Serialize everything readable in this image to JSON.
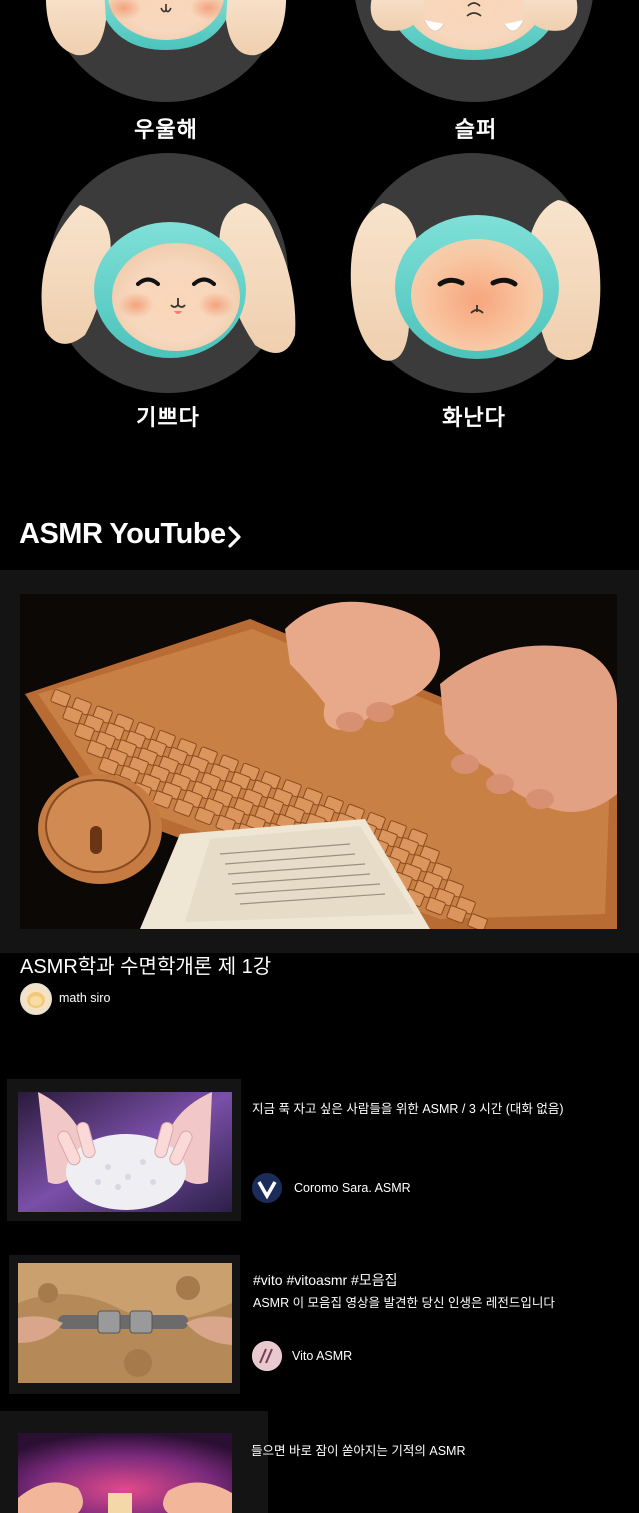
{
  "moods": [
    {
      "label": "우울해",
      "icon": "sad-bunny-icon"
    },
    {
      "label": "슬퍼",
      "icon": "crying-bunny-icon"
    },
    {
      "label": "기쁘다",
      "icon": "happy-bunny-icon"
    },
    {
      "label": "화난다",
      "icon": "angry-bunny-icon"
    }
  ],
  "asmr_section": {
    "title": "ASMR YouTube",
    "more_icon": "chevron-right-icon"
  },
  "featured_video": {
    "thumbnail": "wooden-keyboard-thumbnail",
    "title": "ASMR학과 수면학개론 제 1강",
    "channel": "math siro"
  },
  "videos": [
    {
      "thumbnail": "nails-on-foam-thumbnail",
      "title": "지금 푹 자고 싶은 사람들을 위한 ASMR / 3 시간 (대화 없음)",
      "channel": "Coromo Sara. ASMR"
    },
    {
      "thumbnail": "sand-and-metal-thumbnail",
      "hashtags": "#vito #vitoasmr #모음집",
      "title": "ASMR 이 모음집 영상을 발견한 당신 인생은 레전드입니다",
      "channel": "Vito ASMR"
    },
    {
      "thumbnail": "purple-light-hands-thumbnail",
      "title": "들으면 바로 잠이 쏟아지는 기적의 ASMR"
    }
  ],
  "colors": {
    "background": "#000000",
    "circle": "#3b3b3b",
    "card": "#141414",
    "bunny_skin": "#f5dcc2",
    "bunny_hood": "#6cd6cf",
    "blush": "#f2a884"
  }
}
